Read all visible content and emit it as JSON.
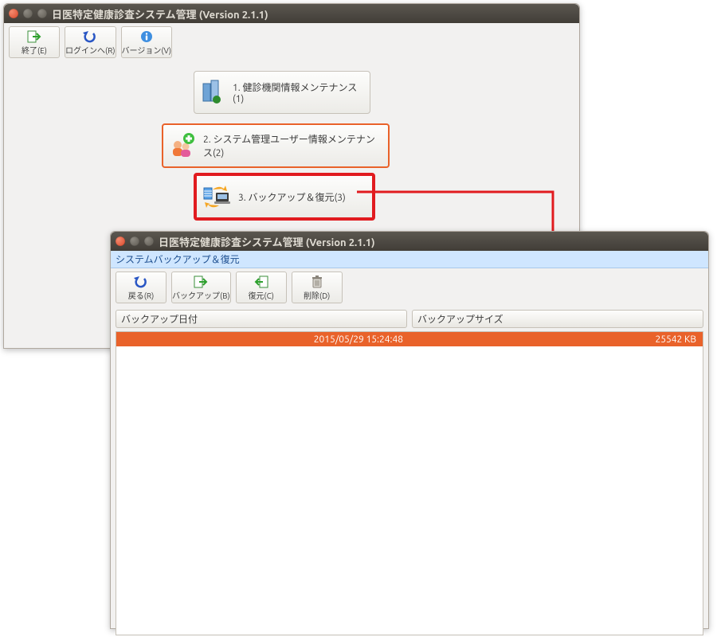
{
  "mainWindow": {
    "title": "日医特定健康診査システム管理 (Version 2.1.1)",
    "toolbar": {
      "exit": "終了(E)",
      "login": "ログインへ(R)",
      "version": "バージョン(V)"
    },
    "menu": {
      "item1": "1. 健診機関情報メンテナンス(1)",
      "item2": "2. システム管理ユーザー情報メンテナンス(2)",
      "item3": "3. バックアップ＆復元(3)"
    }
  },
  "subWindow": {
    "title": "日医特定健康診査システム管理 (Version 2.1.1)",
    "breadcrumb": "システムバックアップ＆復元",
    "toolbar": {
      "back": "戻る(R)",
      "backup": "バックアップ(B)",
      "restore": "復元(C)",
      "delete": "削除(D)"
    },
    "columns": {
      "date": "バックアップ日付",
      "size": "バックアップサイズ"
    },
    "row": {
      "date": "2015/05/29 15:24:48",
      "size": "25542 KB"
    }
  }
}
